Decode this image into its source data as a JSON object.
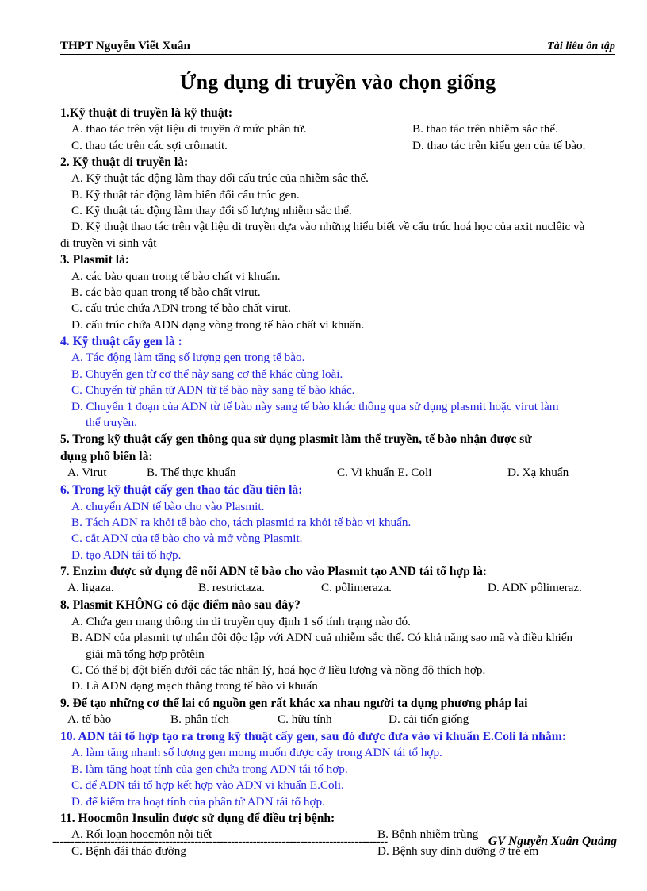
{
  "header": {
    "school": "THPT  Nguyễn Viết Xuân",
    "doc_type": "Tài liêu ôn tập"
  },
  "title": "Ứng dụng di truyền vào chọn giống",
  "footer": {
    "dashes": "--------------------------------------------------------------------------------------------",
    "signature": "GV Nguyễn Xuân Quảng"
  },
  "questions": [
    {
      "number": "1.",
      "stem": "1.Kỹ thuật  di truyền là kỹ thuật:",
      "color": "#000000",
      "layout": "two-column",
      "options": {
        "a": "A. thao tác trên vật liệu  di truyền  ở mức phân tử.",
        "b": "B.  thao tác trên nhiễm  sắc thể.",
        "c": "C. thao tác trên các sợi crômatit.",
        "d": "D. thao tác trên kiểu gen  của tế bào."
      }
    },
    {
      "number": "2.",
      "stem": "2. Kỹ thuật  di truyền là:",
      "color": "#000000",
      "layout": "stacked",
      "options": {
        "a": "A. Kỹ thuật tác động làm thay đổi cấu trúc của nhiễm  sắc thể.",
        "b": "B. Kỹ thuật tác động làm biến đổi cấu trúc gen.",
        "c": "C. Kỹ thuật tác động làm thay đổi số lượng nhiễm  sắc thể.",
        "d": "D. Kỹ thuật thao tác trên vật liệu  di truyền  dựa vào những  hiểu  biết  về cấu trúc  hoá học  của axit  nuclêic  và",
        "d_wrap": "di truyền  vi sinh vật"
      }
    },
    {
      "number": "3.",
      "stem": "3. Plasmit là:",
      "color": "#000000",
      "layout": "stacked",
      "options": {
        "a": "A. các bào quan trong tế bào chất vi khuẩn.",
        "b": "B. các bào quan trong tế bào chất virut.",
        "c": "C. cấu trúc chứa ADN trong tế bào chất virut.",
        "d": "D. cấu trúc chứa ADN dạng vòng trong tế bào chất vi khuẩn."
      }
    },
    {
      "number": "4.",
      "stem": "4. Kỹ thuật  cấy gen là :",
      "color": "#2222dd",
      "layout": "stacked",
      "options": {
        "a": "A. Tác động làm tăng  số lượng  gen trong tế bào.",
        "b": "B. Chuyển  gen từ cơ thể này sang  cơ thể khác cùng loài.",
        "c": "C. Chuyển  từ phân tử ADN từ tế bào này sang tế bào khác.",
        "d": "D. Chuyển  1 đoạn của ADN từ tế bào này sang tế bào khác thông  qua sử dụng plasmit  hoặc virut  làm",
        "d_wrap": "thể truyền."
      }
    },
    {
      "number": "5.",
      "stem": "5. Trong kỹ thuật  cấy gen thông qua sử dụng plasmit làm thể truyền, tế bào nhận được sử",
      "stem_wrap": "dụng phổ biến là:",
      "color": "#000000",
      "layout": "row4",
      "options": {
        "a": "A. Virut",
        "b": "B. Thể thực khuẩn",
        "c": "C. Vi khuẩn E. Coli",
        "d": "D. Xạ khuẩn"
      },
      "col_x": [
        9,
        109,
        349,
        564
      ]
    },
    {
      "number": "6.",
      "stem": "6. Trong kỹ thuật  cấy gen thao tác đầu tiên là:",
      "color": "#2222dd",
      "layout": "stacked",
      "options": {
        "a": "A. chuyển  ADN tế bào cho vào Plasmit.",
        "b": "B. Tách ADN ra khỏi tế bào cho, tách plasmid  ra khỏi tế bào vi khuẩn.",
        "c": "C. cắt ADN của tế bào cho và mở vòng  Plasmit.",
        "d": "D. tạo ADN tái tổ hợp."
      }
    },
    {
      "number": "7.",
      "stem": "7. Enzim  được sử dụng để nối ADN tế bào cho vào Plasmit tạo AND tái tổ hợp là:",
      "color": "#000000",
      "layout": "row4",
      "options": {
        "a": "A. ligaza.",
        "b": "B. restrictaza.",
        "c": "C. pôlimeraza.",
        "d": "D. ADN pôlimeraz."
      },
      "col_x": [
        9,
        174,
        329,
        539
      ]
    },
    {
      "number": "8.",
      "stem": "8. Plasmit KHÔNG  có đặc điểm nào sau đây?",
      "color": "#000000",
      "layout": "stacked",
      "options": {
        "a": "A. Chứa gen mang thông tin  di truyền  quy định  1 số tính  trạng nào đó.",
        "b": "B. ADN của plasmit  tự nhân đôi độc lập với ADN cuả nhiễm  sắc thể. Có khả năng sao mã và điều khiển",
        "b_wrap": "giải  mã tổng hợp prôtêin",
        "c": "C. Có thể bị đột biến dưới các tác nhân lý, hoá học ở liều lượng  và nồng độ thích  hợp.",
        "d": "D. Là ADN dạng mạch thẳng trong tế bào vi khuẩn"
      }
    },
    {
      "number": "9.",
      "stem": "9. Để tạo những  cơ thể lai có nguồn  gen rất khác xa nhau người ta dụng  phương pháp  lai",
      "color": "#000000",
      "layout": "row4",
      "options": {
        "a": "A. tế bào",
        "b": "B. phân tích",
        "c": "C. hữu tính",
        "d": "D. cải tiến  giống"
      },
      "col_x": [
        9,
        139,
        274,
        414
      ]
    },
    {
      "number": "10.",
      "stem": "10. ADN tái tổ hợp tạo ra trong kỹ thuật cấy gen, sau đó được đưa vào vi khuẩn E.Coli là nhằm:",
      "color": "#2222dd",
      "layout": "stacked",
      "options": {
        "a": "A. làm tăng nhanh  số lượng  gen mong muốn  được cấy trong  ADN tái tổ hợp.",
        "b": "B. làm tăng hoạt tính của gen chứa trong ADN tái tổ hợp.",
        "c": "C. để ADN tái tổ hợp kết hợp vào ADN vi khuẩn E.Coli.",
        "d": "D. để kiểm tra hoạt tính  của phân tử ADN tái tổ hợp."
      }
    },
    {
      "number": "11.",
      "stem": "11. Hoocmôn  Insulin  được sử dụng  để điều trị bệnh:",
      "color": "#000000",
      "layout": "two-column",
      "options": {
        "a": "A. Rối loạn hoocmôn  nội tiết",
        "b": "B. Bệnh nhiễm  trùng",
        "c": "C. Bệnh  đái tháo đường",
        "d": "D. Bệnh suy dinh dưỡng ở trẻ em"
      }
    }
  ]
}
